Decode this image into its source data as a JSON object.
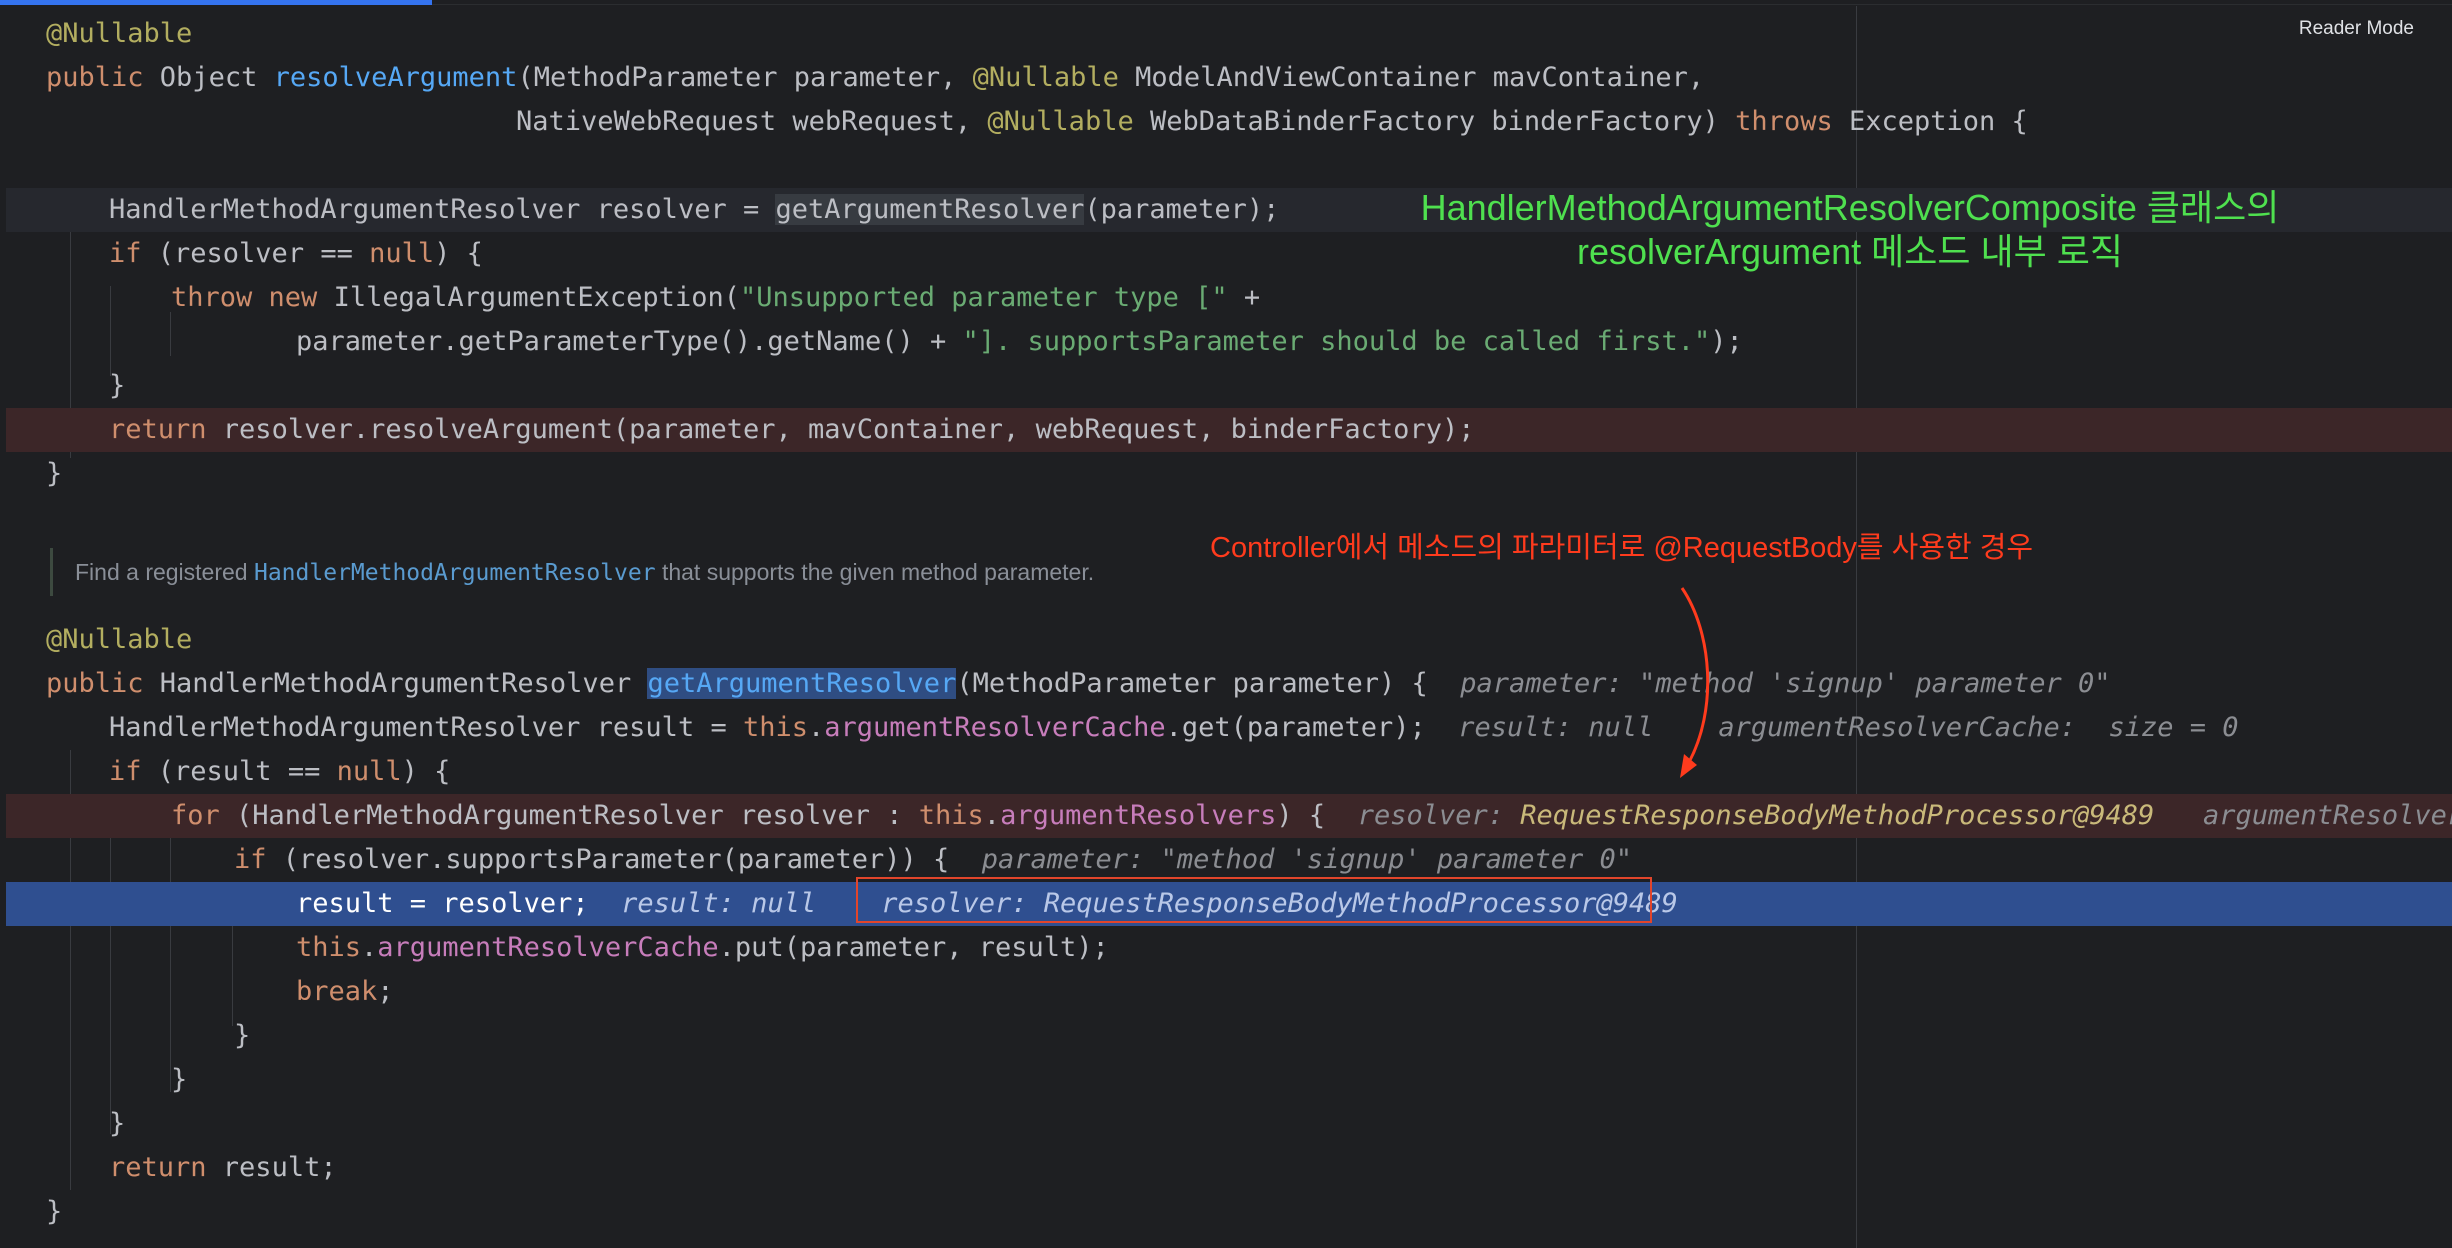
{
  "reader_mode_label": "Reader Mode",
  "notes": {
    "green_line1": "HandlerMethodArgumentResolverComposite 클래스의",
    "green_line2": "resolverArgument 메소드 내부 로직",
    "red": "Controller에서 메소드의 파라미터로 @RequestBody를 사용한 경우"
  },
  "doc": {
    "prefix": "Find a registered ",
    "ref": "HandlerMethodArgumentResolver",
    "suffix": " that supports the given method parameter."
  },
  "code": {
    "l1_ann": "@Nullable",
    "l2_public": "public ",
    "l2_obj": "Object ",
    "l2_fn": "resolveArgument",
    "l2_a": "(MethodParameter parameter, ",
    "l2_ann": "@Nullable",
    "l2_b": " ModelAndViewContainer mavContainer,",
    "l3_a": "NativeWebRequest webRequest, ",
    "l3_ann": "@Nullable",
    "l3_b": " WebDataBinderFactory binderFactory) ",
    "l3_throws": "throws",
    "l3_c": " Exception {",
    "l5_a": "HandlerMethodArgumentResolver resolver = ",
    "l5_call": "getArgumentResolver",
    "l5_b": "(parameter);",
    "l6_if": "if",
    "l6_a": " (resolver == ",
    "l6_null": "null",
    "l6_b": ") {",
    "l7_throw": "throw ",
    "l7_new": "new ",
    "l7_a": "IllegalArgumentException(",
    "l7_str": "\"Unsupported parameter type [\"",
    "l7_b": " +",
    "l8_a": "parameter.getParameterType().getName() + ",
    "l8_str": "\"]. supportsParameter should be called first.\"",
    "l8_b": ");",
    "l9": "}",
    "l10_return": "return ",
    "l10_a": "resolver.resolveArgument(parameter, mavContainer, webRequest, binderFactory);",
    "l11": "}",
    "l13_ann": "@Nullable",
    "l14_public": "public ",
    "l14_a": "HandlerMethodArgumentResolver ",
    "l14_fn": "getArgumentResolver",
    "l14_b": "(MethodParameter parameter) {",
    "l14_hint": "parameter: \"method 'signup' parameter 0\"",
    "l15_a": "HandlerMethodArgumentResolver result = ",
    "l15_this": "this",
    "l15_dot": ".",
    "l15_fld": "argumentResolverCache",
    "l15_b": ".get(parameter);",
    "l15_hint1": "result: null",
    "l15_hint2": "argumentResolverCache:  size = 0",
    "l16_if": "if",
    "l16_a": " (result == ",
    "l16_null": "null",
    "l16_b": ") {",
    "l17_for": "for",
    "l17_a": " (HandlerMethodArgumentResolver resolver : ",
    "l17_this": "this",
    "l17_dot": ".",
    "l17_fld": "argumentResolvers",
    "l17_b": ") {",
    "l17_hint_key": "resolver: ",
    "l17_hint_val": "RequestResponseBodyMethodProcessor@9489",
    "l17_hint2": "argumentResolvers:",
    "l18_if": "if",
    "l18_a": " (resolver.supportsParameter(parameter)) {",
    "l18_hint": "parameter: \"method 'signup' parameter 0\"",
    "l19_a": "result = resolver;",
    "l19_hint1": "result: null",
    "l19_hint2": "resolver: RequestResponseBodyMethodProcessor@9489",
    "l20_this": "this",
    "l20_dot": ".",
    "l20_fld": "argumentResolverCache",
    "l20_b": ".put(parameter, result);",
    "l21_break": "break",
    "l21_b": ";",
    "l22": "}",
    "l23": "}",
    "l24": "}",
    "l25_return": "return ",
    "l25_a": "result;",
    "l26": "}"
  },
  "colors": {
    "background": "#1e1f22",
    "keyword": "#cf8e6d",
    "annotation": "#b3ae60",
    "function": "#56a8f5",
    "string": "#6aab73",
    "field": "#c77dbb",
    "breakpoint_line": "#3c2628",
    "execution_line": "#2f4f90",
    "note_green": "#4fe04f",
    "note_red": "#ff3b1d"
  }
}
